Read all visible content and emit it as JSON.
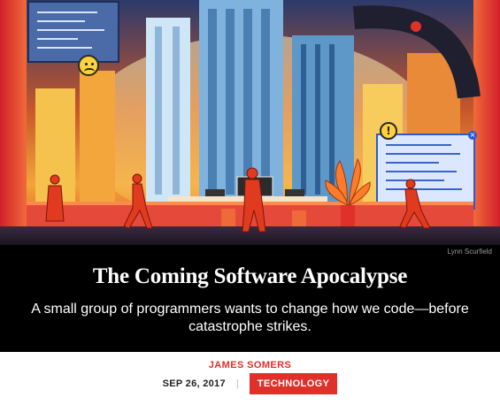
{
  "article": {
    "photo_credit": "Lynn Scurfield",
    "headline": "The Coming Software Apocalypse",
    "subhead": "A small group of programmers wants to change how we code—before catastrophe strikes.",
    "author": "JAMES SOMERS",
    "date": "SEP 26, 2017",
    "separator": "|",
    "section_tag": "TECHNOLOGY"
  },
  "colors": {
    "accent": "#e0302a",
    "band": "#000000",
    "headline_text": "#ffffff"
  },
  "icons": {
    "frown_face": "sad-face-icon",
    "warning": "warning-icon",
    "close": "close-icon"
  }
}
